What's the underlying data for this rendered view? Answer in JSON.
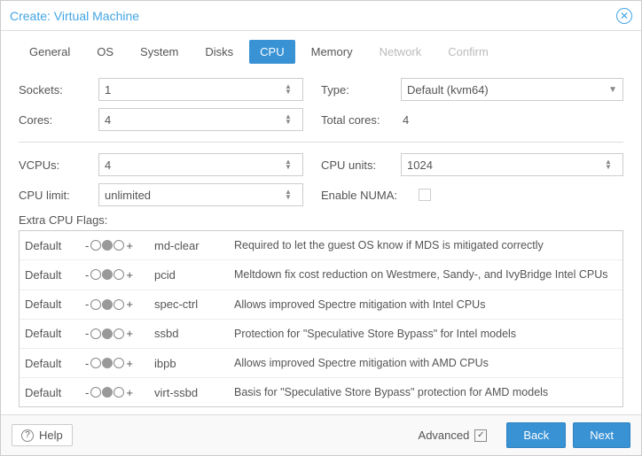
{
  "title": "Create: Virtual Machine",
  "tabs": [
    "General",
    "OS",
    "System",
    "Disks",
    "CPU",
    "Memory",
    "Network",
    "Confirm"
  ],
  "activeTab": 4,
  "fields": {
    "sockets_label": "Sockets:",
    "sockets_value": "1",
    "cores_label": "Cores:",
    "cores_value": "4",
    "type_label": "Type:",
    "type_value": "Default (kvm64)",
    "totalcores_label": "Total cores:",
    "totalcores_value": "4",
    "vcpus_label": "VCPUs:",
    "vcpus_value": "4",
    "cpuunits_label": "CPU units:",
    "cpuunits_value": "1024",
    "cpulimit_label": "CPU limit:",
    "cpulimit_value": "unlimited",
    "numa_label": "Enable NUMA:"
  },
  "flags_label": "Extra CPU Flags:",
  "default_text": "Default",
  "flags": [
    {
      "name": "md-clear",
      "desc": "Required to let the guest OS know if MDS is mitigated correctly"
    },
    {
      "name": "pcid",
      "desc": "Meltdown fix cost reduction on Westmere, Sandy-, and IvyBridge Intel CPUs"
    },
    {
      "name": "spec-ctrl",
      "desc": "Allows improved Spectre mitigation with Intel CPUs"
    },
    {
      "name": "ssbd",
      "desc": "Protection for \"Speculative Store Bypass\" for Intel models"
    },
    {
      "name": "ibpb",
      "desc": "Allows improved Spectre mitigation with AMD CPUs"
    },
    {
      "name": "virt-ssbd",
      "desc": "Basis for \"Speculative Store Bypass\" protection for AMD models"
    }
  ],
  "footer": {
    "help": "Help",
    "advanced": "Advanced",
    "back": "Back",
    "next": "Next"
  }
}
